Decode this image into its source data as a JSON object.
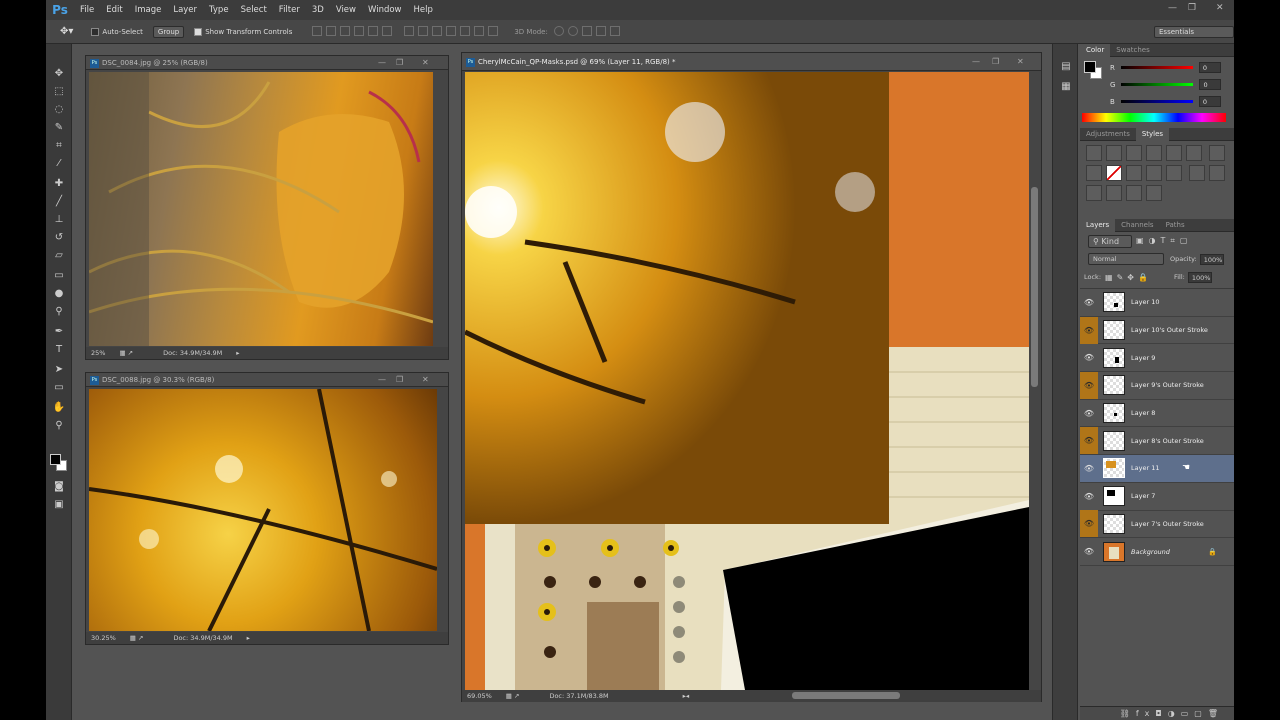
{
  "app": {
    "logo": "Ps",
    "menu": [
      "File",
      "Edit",
      "Image",
      "Layer",
      "Type",
      "Select",
      "Filter",
      "3D",
      "View",
      "Window",
      "Help"
    ]
  },
  "options": {
    "auto_select": "Auto-Select",
    "group": "Group",
    "show_transform": "Show Transform Controls",
    "mode_3d": "3D Mode:",
    "workspace": "Essentials"
  },
  "docs": {
    "doc1": {
      "title": "DSC_0084.jpg @ 25% (RGB/8)",
      "zoom": "25%",
      "doc": "Doc: 34.9M/34.9M"
    },
    "doc2": {
      "title": "DSC_0088.jpg @ 30.3% (RGB/8)",
      "zoom": "30.25%",
      "doc": "Doc: 34.9M/34.9M"
    },
    "main": {
      "title": "CherylMcCain_QP-Masks.psd @ 69% (Layer 11, RGB/8) *",
      "zoom": "69.05%",
      "doc": "Doc: 37.1M/83.8M"
    }
  },
  "color_panel": {
    "tabs": [
      "Color",
      "Swatches"
    ],
    "r_label": "R",
    "g_label": "G",
    "b_label": "B",
    "r": "0",
    "g": "0",
    "b": "0"
  },
  "adjust_panel": {
    "tabs": [
      "Adjustments",
      "Styles"
    ]
  },
  "layers_panel": {
    "tabs": [
      "Layers",
      "Channels",
      "Paths"
    ],
    "kind": "Kind",
    "blend": "Normal",
    "opacity_label": "Opacity:",
    "opacity": "100%",
    "lock_label": "Lock:",
    "fill_label": "Fill:",
    "fill": "100%",
    "layers": [
      {
        "name": "Layer 10",
        "effect": false
      },
      {
        "name": "Layer 10's Outer Stroke",
        "effect": true
      },
      {
        "name": "Layer 9",
        "effect": false
      },
      {
        "name": "Layer 9's Outer Stroke",
        "effect": true
      },
      {
        "name": "Layer 8",
        "effect": false
      },
      {
        "name": "Layer 8's Outer Stroke",
        "effect": true
      },
      {
        "name": "Layer 11",
        "effect": false,
        "selected": true
      },
      {
        "name": "Layer 7",
        "effect": false
      },
      {
        "name": "Layer 7's Outer Stroke",
        "effect": true
      },
      {
        "name": "Background",
        "effect": false,
        "locked": true
      }
    ]
  }
}
